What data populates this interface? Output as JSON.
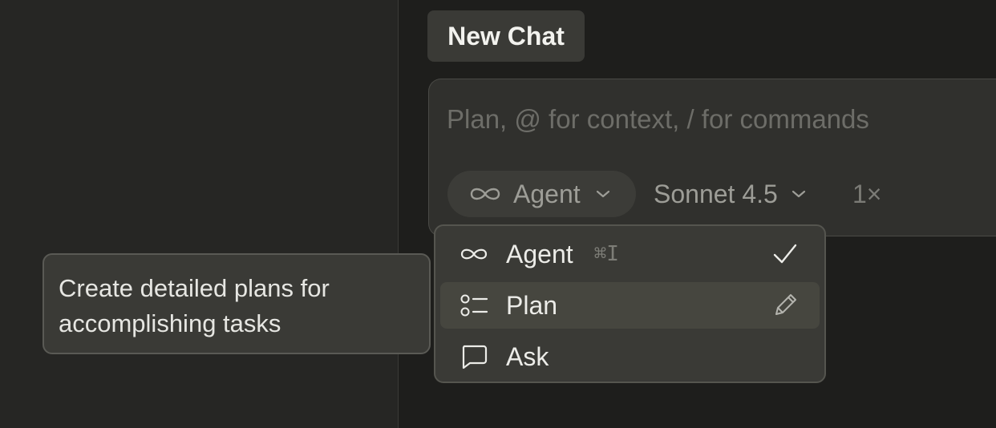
{
  "tab": {
    "title": "New Chat"
  },
  "composer": {
    "placeholder": "Plan, @ for context, / for commands",
    "mode_label": "Agent",
    "model_label": "Sonnet 4.5",
    "multiplier": "1×"
  },
  "menu": {
    "items": [
      {
        "icon": "infinity-icon",
        "label": "Agent",
        "shortcut": "⌘I",
        "selected": true
      },
      {
        "icon": "plan-list-icon",
        "label": "Plan",
        "shortcut": "",
        "hovered": true
      },
      {
        "icon": "chat-bubble-icon",
        "label": "Ask",
        "shortcut": ""
      }
    ]
  },
  "tooltip": {
    "text": "Create detailed plans for accomplishing tasks"
  },
  "colors": {
    "background": "#1e1e1c",
    "sidebar": "#262624",
    "composer": "#30302d",
    "menu": "#3a3a36",
    "text": "#ecece8",
    "muted": "#9d9d97"
  }
}
